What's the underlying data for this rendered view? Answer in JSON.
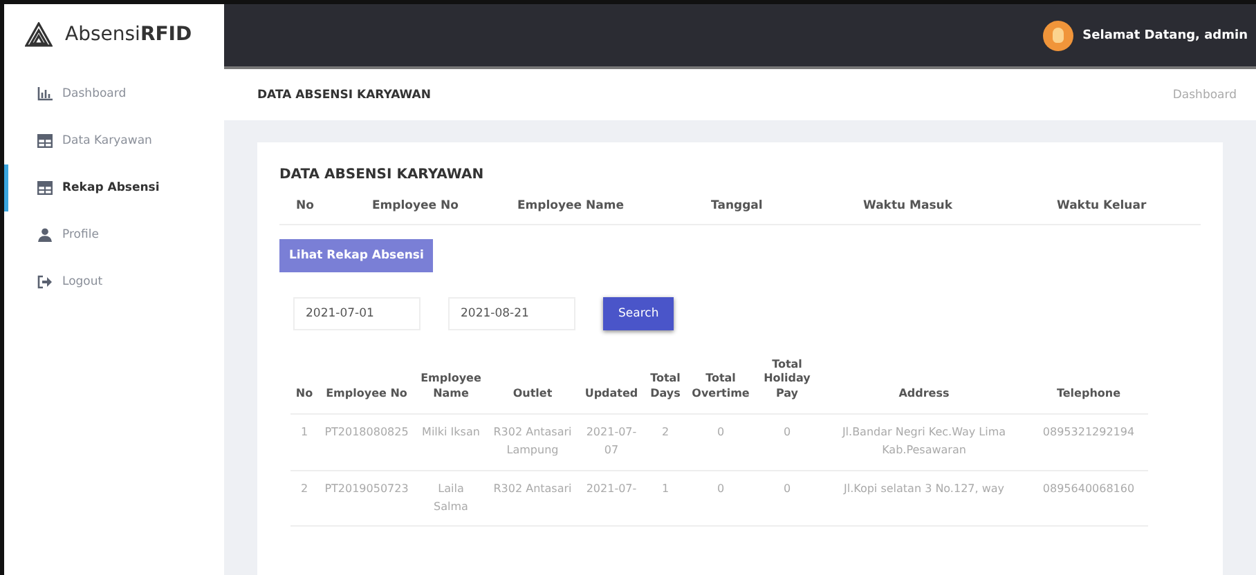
{
  "brand": {
    "name": "Absensi",
    "bold": "RFID"
  },
  "topbar": {
    "greeting": "Selamat Datang, admin"
  },
  "sidebar": {
    "items": [
      {
        "label": "Dashboard",
        "kind": "chart",
        "selected": false
      },
      {
        "label": "Data Karyawan",
        "kind": "table",
        "selected": false
      },
      {
        "label": "Rekap Absensi",
        "kind": "table",
        "selected": true
      },
      {
        "label": "Profile",
        "kind": "user",
        "selected": false
      },
      {
        "label": "Logout",
        "kind": "logout",
        "selected": false
      }
    ]
  },
  "page_header": {
    "title": "DATA ABSENSI KARYAWAN",
    "breadcrumb": "Dashboard"
  },
  "card": {
    "title": "DATA ABSENSI KARYAWAN",
    "summary_columns": [
      "No",
      "Employee No",
      "Employee Name",
      "Tanggal",
      "Waktu Masuk",
      "Waktu Keluar"
    ],
    "recap_button": "Lihat Rekap Absensi",
    "filter": {
      "start_date": "2021-07-01",
      "end_date": "2021-08-21",
      "search_button": "Search"
    },
    "table": {
      "columns": [
        "No",
        "Employee No",
        "Employee Name",
        "Outlet",
        "Updated",
        "Total Days",
        "Total Overtime",
        "Total Holiday Pay",
        "Address",
        "Telephone"
      ],
      "rows": [
        [
          "1",
          "PT2018080825",
          "Milki Iksan",
          "R302 Antasari Lampung",
          "2021-07-07",
          "2",
          "0",
          "0",
          "Jl.Bandar Negri Kec.Way Lima Kab.Pesawaran",
          "0895321292194"
        ],
        [
          "2",
          "PT2019050723",
          "Laila Salma",
          "R302 Antasari",
          "2021-07-",
          "1",
          "0",
          "0",
          "Jl.Kopi selatan 3 No.127, way",
          "0895640068160"
        ]
      ]
    }
  }
}
